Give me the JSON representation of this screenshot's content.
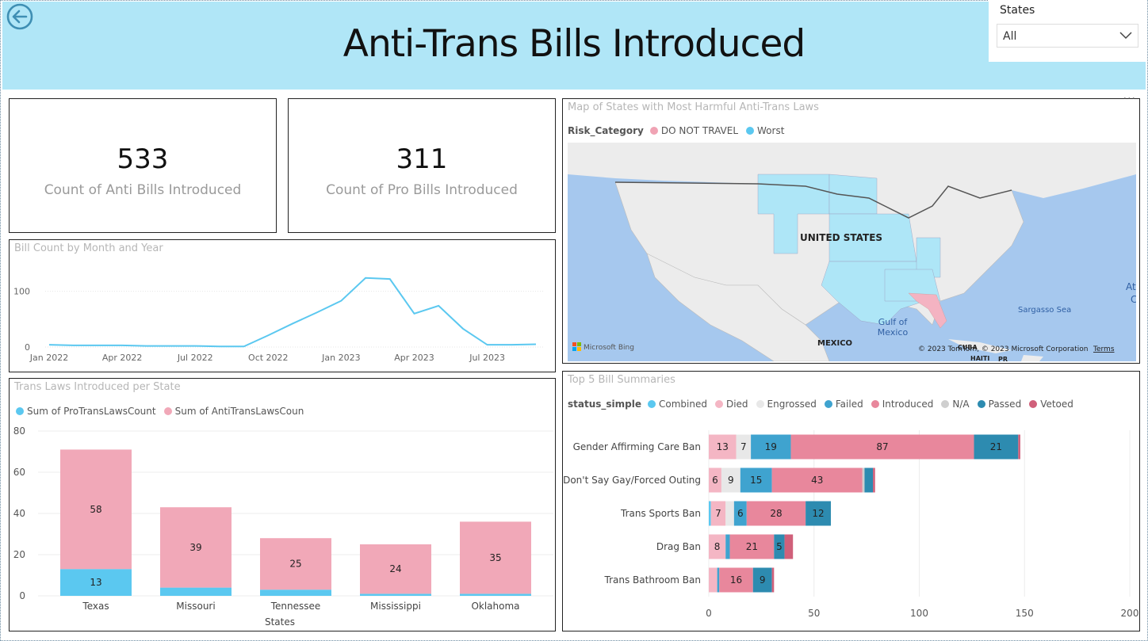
{
  "header": {
    "title": "Anti-Trans Bills Introduced"
  },
  "slicer": {
    "label": "States",
    "value": "All"
  },
  "kpis": {
    "anti": {
      "value": "533",
      "label": "Count of Anti Bills Introduced"
    },
    "pro": {
      "value": "311",
      "label": "Count of Pro Bills Introduced"
    }
  },
  "map": {
    "title": "Map of States with Most Harmful Anti-Trans Laws",
    "legend_title": "Risk_Category",
    "legend": [
      {
        "name": "DO NOT TRAVEL",
        "color": "#f0a3b4"
      },
      {
        "name": "Worst",
        "color": "#5bc8f0"
      }
    ],
    "labels": {
      "country": "UNITED STATES",
      "gulf1": "Gulf of",
      "gulf2": "Mexico",
      "mexico": "MEXICO",
      "sargasso": "Sargasso Sea",
      "cuba": "CUBA",
      "haiti": "HAITI",
      "pr": "PR",
      "at": "At",
      "c": "C",
      "bing": "Microsoft Bing",
      "copyright": "© 2023 TomTom, © 2023 Microsoft Corporation",
      "terms": "Terms"
    },
    "colors": {
      "water": "#a6c8ee",
      "land": "#ececec",
      "worst": "#aee6f7",
      "donot": "#f4b3c2"
    }
  },
  "chart_data": [
    {
      "type": "line",
      "title": "Bill Count by Month and Year",
      "x": [
        "Jan 2022",
        "Feb 2022",
        "Mar 2022",
        "Apr 2022",
        "May 2022",
        "Jun 2022",
        "Jul 2022",
        "Aug 2022",
        "Sep 2022",
        "Oct 2022",
        "Nov 2022",
        "Dec 2022",
        "Jan 2023",
        "Feb 2023",
        "Mar 2023",
        "Apr 2023",
        "May 2023",
        "Jun 2023",
        "Jul 2023",
        "Aug 2023",
        "Sep 2023"
      ],
      "values": [
        4,
        3,
        3,
        3,
        2,
        2,
        2,
        1,
        1,
        21,
        42,
        62,
        83,
        124,
        122,
        60,
        74,
        33,
        4,
        4,
        5
      ],
      "x_ticks": [
        "Jan 2022",
        "Apr 2022",
        "Jul 2022",
        "Oct 2022",
        "Jan 2023",
        "Apr 2023",
        "Jul 2023"
      ],
      "y_ticks": [
        "0",
        "100"
      ],
      "ylim": [
        0,
        135
      ],
      "color": "#5bc8f0"
    },
    {
      "type": "bar",
      "stacked": true,
      "title": "Trans Laws Introduced per State",
      "xlabel": "States",
      "categories": [
        "Texas",
        "Missouri",
        "Tennessee",
        "Mississippi",
        "Oklahoma"
      ],
      "series": [
        {
          "name": "Sum of ProTransLawsCount",
          "color": "#5bc8f0",
          "values": [
            13,
            4,
            3,
            1,
            1
          ],
          "labels": [
            "13",
            "",
            "",
            "",
            ""
          ]
        },
        {
          "name": "Sum of AntiTransLawsCoun",
          "color": "#f1a8b8",
          "values": [
            58,
            39,
            25,
            24,
            35
          ],
          "labels": [
            "58",
            "39",
            "25",
            "24",
            "35"
          ]
        }
      ],
      "y_ticks": [
        "0",
        "20",
        "40",
        "60",
        "80"
      ],
      "ylim": [
        0,
        80
      ]
    },
    {
      "type": "bar",
      "orientation": "horizontal",
      "stacked": true,
      "title": "Top 5 Bill Summaries",
      "legend_title": "status_simple",
      "categories": [
        "Gender Affirming Care Ban",
        "Don't Say Gay/Forced Outing",
        "Trans Sports Ban",
        "Drag Ban",
        "Trans Bathroom Ban"
      ],
      "series": [
        {
          "name": "Combined",
          "color": "#5bc8f0",
          "values": [
            0,
            0,
            1,
            0,
            0
          ]
        },
        {
          "name": "Died",
          "color": "#f4b6c4",
          "values": [
            13,
            6,
            7,
            8,
            4
          ]
        },
        {
          "name": "Engrossed",
          "color": "#e8e8e8",
          "values": [
            7,
            9,
            4,
            0,
            0
          ]
        },
        {
          "name": "Failed",
          "color": "#3fa3cf",
          "values": [
            19,
            15,
            6,
            2,
            1
          ]
        },
        {
          "name": "Introduced",
          "color": "#e8879c",
          "values": [
            87,
            43,
            28,
            21,
            16
          ]
        },
        {
          "name": "N/A",
          "color": "#cfcfcf",
          "values": [
            0,
            1,
            0,
            0,
            0
          ]
        },
        {
          "name": "Passed",
          "color": "#2d8bb0",
          "values": [
            21,
            4,
            12,
            5,
            9
          ]
        },
        {
          "name": "Vetoed",
          "color": "#d0607a",
          "values": [
            1,
            1,
            0,
            4,
            1
          ]
        }
      ],
      "labels": [
        [
          "",
          "13",
          "7",
          "19",
          "87",
          "",
          "21",
          ""
        ],
        [
          "",
          "6",
          "9",
          "15",
          "43",
          "",
          "",
          ""
        ],
        [
          "",
          "7",
          "",
          "6",
          "28",
          "",
          "12",
          ""
        ],
        [
          "",
          "8",
          "",
          "",
          "21",
          "",
          "5",
          ""
        ],
        [
          "",
          "",
          "",
          "",
          "16",
          "",
          "9",
          ""
        ]
      ],
      "x_ticks": [
        "0",
        "50",
        "100",
        "150",
        "200"
      ],
      "xlim": [
        0,
        200
      ]
    }
  ]
}
